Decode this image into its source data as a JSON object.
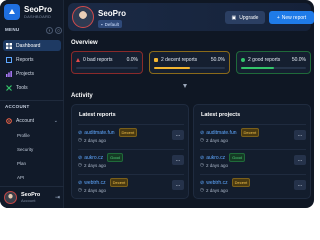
{
  "brand": {
    "title": "SeoPro",
    "subtitle": "DASHBOARD"
  },
  "sidebar": {
    "menu_label": "MENU",
    "items": [
      {
        "label": "Dashboard",
        "icon": "grid-icon",
        "active": true
      },
      {
        "label": "Reports",
        "icon": "report-icon",
        "active": false
      },
      {
        "label": "Projects",
        "icon": "chart-icon",
        "active": false
      },
      {
        "label": "Tools",
        "icon": "tools-icon",
        "active": false
      }
    ],
    "account_label": "ACCOUNT",
    "account_item": {
      "label": "Account",
      "icon": "settings-icon"
    },
    "account_sub": [
      "Profile",
      "Security",
      "Plan",
      "API"
    ],
    "user": {
      "name": "SeoPro",
      "role": "Account"
    }
  },
  "header": {
    "name": "SeoPro",
    "badge": "Default",
    "upgrade_label": "Upgrade",
    "new_report_label": "New report"
  },
  "overview": {
    "title": "Overview",
    "cards": [
      {
        "label": "0 bad reports",
        "pct": "0.0%",
        "value": 0.0,
        "color": "#e24a4a"
      },
      {
        "label": "2 decent reports",
        "pct": "50.0%",
        "value": 50.0,
        "color": "#f2b531"
      },
      {
        "label": "2 good reports",
        "pct": "50.0%",
        "value": 50.0,
        "color": "#33c46a"
      }
    ]
  },
  "activity": {
    "title": "Activity",
    "latest_reports": {
      "title": "Latest reports",
      "rows": [
        {
          "site": "auditmate.fun",
          "tag": "Decent",
          "date": "2 days ago"
        },
        {
          "site": "aukro.cz",
          "tag": "Good",
          "date": "2 days ago"
        },
        {
          "site": "webtrh.cz",
          "tag": "Decent",
          "date": "2 days ago"
        }
      ]
    },
    "latest_projects": {
      "title": "Latest projects",
      "rows": [
        {
          "site": "auditmate.fun",
          "tag": "Decent",
          "date": "2 days ago"
        },
        {
          "site": "aukro.cz",
          "tag": "Good",
          "date": "2 days ago"
        },
        {
          "site": "webtrh.cz",
          "tag": "Decent",
          "date": "2 days ago"
        }
      ]
    },
    "more_label": "..."
  }
}
